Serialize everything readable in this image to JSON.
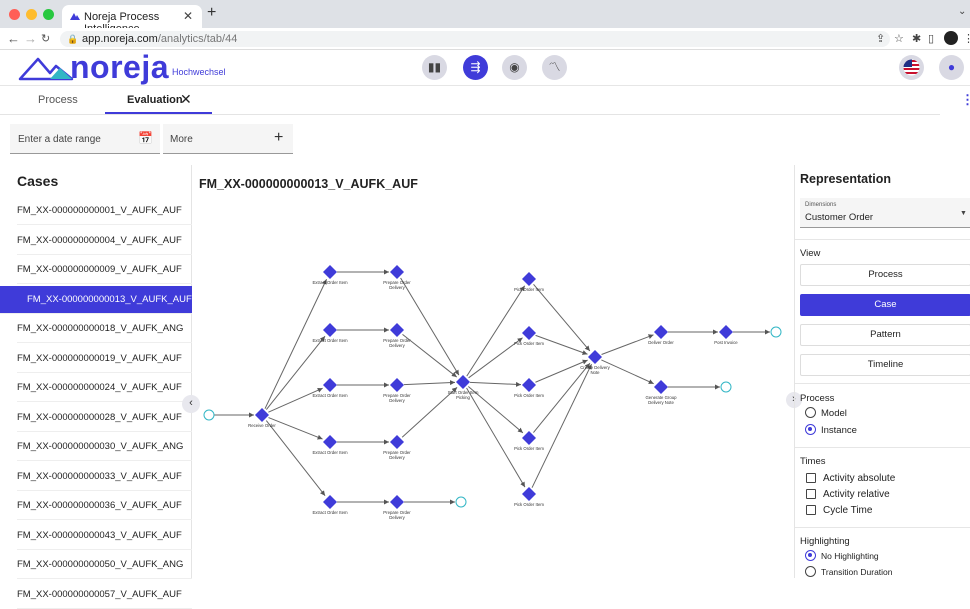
{
  "browser": {
    "tab_title": "Noreja Process Intelligence",
    "url_host": "app.noreja.com",
    "url_path": "/analytics/tab/44"
  },
  "header": {
    "logo_text": "noreja",
    "logo_sub": "Hochwechsel",
    "accent": "#3f3bd9"
  },
  "tabs": [
    {
      "label": "Process"
    },
    {
      "label": "Evaluation"
    }
  ],
  "filters": {
    "date_placeholder": "Enter a date range",
    "more_label": "More"
  },
  "cases": {
    "title": "Cases",
    "items": [
      "FM_XX-000000000001_V_AUFK_AUF",
      "FM_XX-000000000004_V_AUFK_AUF",
      "FM_XX-000000000009_V_AUFK_AUF",
      "FM_XX-000000000013_V_AUFK_AUF",
      "FM_XX-000000000018_V_AUFK_ANG",
      "FM_XX-000000000019_V_AUFK_AUF",
      "FM_XX-000000000024_V_AUFK_AUF",
      "FM_XX-000000000028_V_AUFK_AUF",
      "FM_XX-000000000030_V_AUFK_ANG",
      "FM_XX-000000000033_V_AUFK_AUF",
      "FM_XX-000000000036_V_AUFK_AUF",
      "FM_XX-000000000043_V_AUFK_AUF",
      "FM_XX-000000000050_V_AUFK_ANG",
      "FM_XX-000000000057_V_AUFK_AUF"
    ],
    "selected_index": 3
  },
  "graph": {
    "title": "FM_XX-000000000013_V_AUFK_AUF",
    "labels": {
      "receive": "Receive Order",
      "extract": "Extract Order Item",
      "prepare": [
        "Prepare Order",
        "Delivery"
      ],
      "start_picking": [
        "Start Order Item",
        "Picking"
      ],
      "pick": "Pick Order Item",
      "create_note": [
        "Create Delivery",
        "Note"
      ],
      "deliver": "Deliver Order",
      "post_invoice": "Post Invoice",
      "group_note": [
        "Generate Group",
        "Delivery Note"
      ]
    }
  },
  "representation": {
    "title": "Representation",
    "dimensions_label": "Dimensions",
    "dimensions_value": "Customer Order",
    "view_label": "View",
    "view_buttons": [
      "Process",
      "Case",
      "Pattern",
      "Timeline"
    ],
    "view_selected": 1,
    "process_label": "Process",
    "process_options": [
      "Model",
      "Instance"
    ],
    "process_selected": 1,
    "times_label": "Times",
    "times_options": [
      "Activity absolute",
      "Activity relative",
      "Cycle Time"
    ],
    "highlighting_label": "Highlighting",
    "highlighting_options": [
      "No Highlighting",
      "Transition Duration"
    ],
    "highlighting_selected": 0
  }
}
